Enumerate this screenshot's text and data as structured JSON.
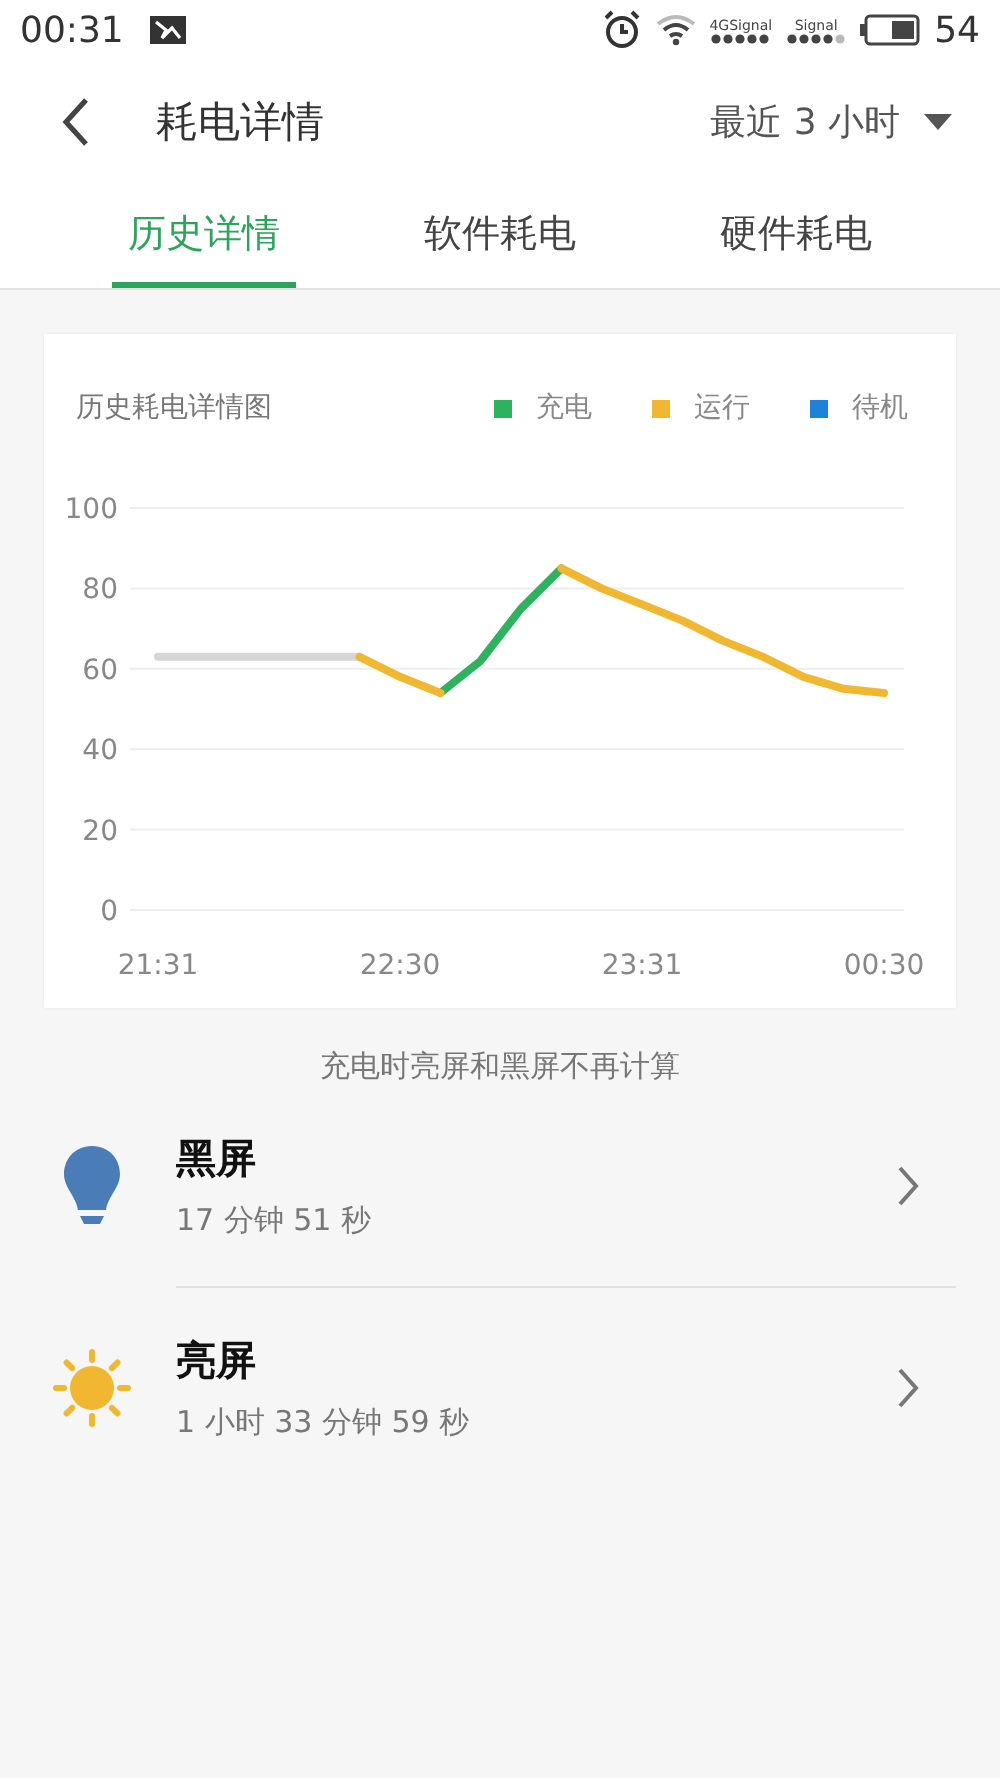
{
  "status_bar": {
    "time": "00:31",
    "signal_1_label": "4GSignal",
    "signal_2_label": "Signal",
    "battery": "54"
  },
  "header": {
    "title": "耗电详情",
    "range": "最近 3 小时"
  },
  "tabs": [
    {
      "label": "历史详情",
      "selected": true
    },
    {
      "label": "软件耗电",
      "selected": false
    },
    {
      "label": "硬件耗电",
      "selected": false
    }
  ],
  "chart_card": {
    "chart_data": {
      "type": "line",
      "title": "历史耗电详情图",
      "categories": [
        "21:31",
        null,
        null,
        null,
        null,
        null,
        "22:30",
        null,
        null,
        null,
        null,
        null,
        "23:31",
        null,
        null,
        null,
        null,
        null,
        "00:30"
      ],
      "series": [
        {
          "color": "#d6d6d6",
          "values": [
            63,
            63,
            63,
            63,
            63,
            63,
            null,
            null,
            null,
            null,
            null,
            null,
            null,
            null,
            null,
            null,
            null,
            null,
            null
          ]
        },
        {
          "name": "充电",
          "color": "#2db35d",
          "values": [
            null,
            null,
            null,
            null,
            null,
            null,
            null,
            54,
            62,
            75,
            85,
            null,
            null,
            null,
            null,
            null,
            null,
            null,
            null
          ]
        },
        {
          "name": "运行",
          "color": "#f2b731",
          "values": [
            null,
            null,
            null,
            null,
            null,
            63,
            58,
            54,
            null,
            null,
            85,
            80,
            76,
            72,
            67,
            63,
            58,
            55,
            54
          ]
        },
        {
          "name": "待机",
          "color": "#1e82d8",
          "values": [
            null,
            null,
            null,
            null,
            null,
            null,
            null,
            null,
            null,
            null,
            null,
            null,
            null,
            null,
            null,
            null,
            null,
            null,
            null
          ]
        }
      ],
      "ylim": [
        0,
        100
      ],
      "grid": true,
      "yticks": [
        0,
        20,
        40,
        60,
        80,
        100
      ]
    }
  },
  "note": "充电时亮屏和黑屏不再计算",
  "items": [
    {
      "kind": "bulb",
      "title": "黑屏",
      "duration": "17 分钟 51 秒"
    },
    {
      "kind": "sun",
      "title": "亮屏",
      "duration": "1 小时 33 分钟 59 秒"
    }
  ]
}
